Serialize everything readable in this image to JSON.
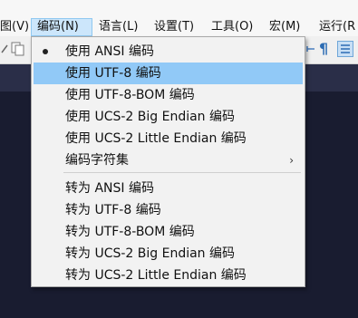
{
  "menubar": {
    "items": [
      {
        "label": "图(V)"
      },
      {
        "label": "编码(N)"
      },
      {
        "label": "语言(L)"
      },
      {
        "label": "设置(T)"
      },
      {
        "label": "工具(O)"
      },
      {
        "label": "宏(M)"
      },
      {
        "label": "运行(R"
      }
    ],
    "active_index": 1
  },
  "toolbar": {
    "pilcrow_glyph": "¶"
  },
  "encoding_menu": {
    "items": [
      {
        "label": "使用 ANSI 编码",
        "checked": true
      },
      {
        "label": "使用 UTF-8 编码",
        "highlighted": true
      },
      {
        "label": "使用 UTF-8-BOM 编码"
      },
      {
        "label": "使用 UCS-2 Big Endian 编码"
      },
      {
        "label": "使用 UCS-2 Little Endian 编码"
      },
      {
        "label": "编码字符集",
        "submenu_arrow": "›"
      },
      {
        "label": "转为 ANSI 编码"
      },
      {
        "label": "转为 UTF-8 编码"
      },
      {
        "label": "转为 UTF-8-BOM 编码"
      },
      {
        "label": "转为 UCS-2 Big Endian 编码"
      },
      {
        "label": "转为 UCS-2 Little Endian 编码"
      }
    ]
  },
  "colors": {
    "highlight": "#91c9f7",
    "editor_background": "#191c30",
    "menu_background": "#f2f2f2"
  }
}
